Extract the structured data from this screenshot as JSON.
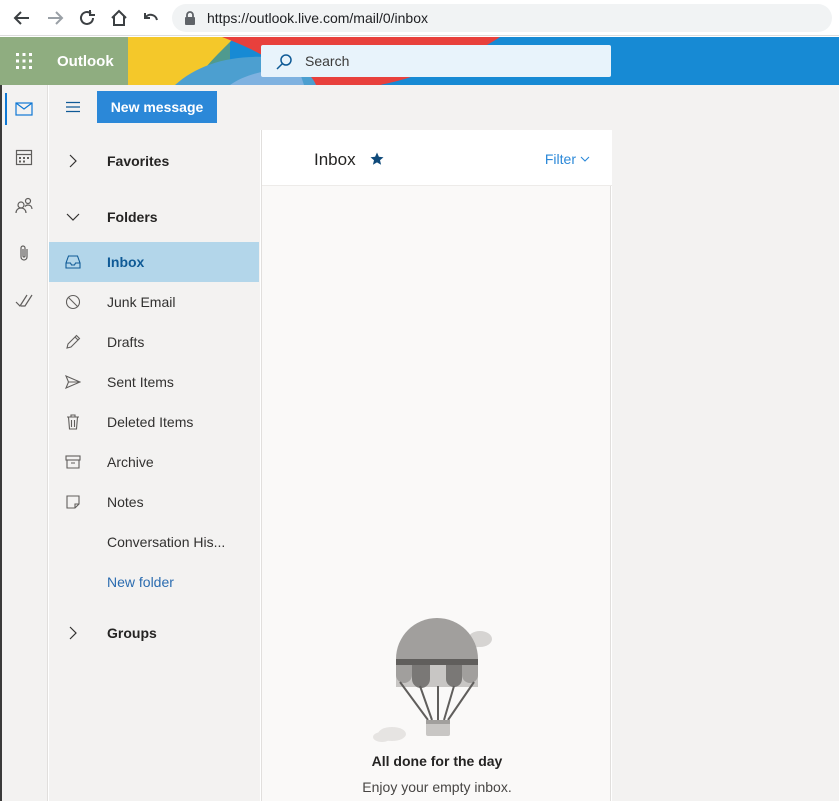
{
  "browser": {
    "url": "https://outlook.live.com/mail/0/inbox"
  },
  "app": {
    "brand": "Outlook",
    "accent_color": "#0f78d4",
    "brand_color": "#8fad80"
  },
  "search": {
    "placeholder": "Search"
  },
  "rail": {
    "items": [
      {
        "icon": "mail-icon",
        "active": true
      },
      {
        "icon": "calendar-icon",
        "active": false
      },
      {
        "icon": "people-icon",
        "active": false
      },
      {
        "icon": "attachment-icon",
        "active": false
      },
      {
        "icon": "todo-check-icon",
        "active": false
      }
    ]
  },
  "toolbar": {
    "new_message_label": "New message"
  },
  "folder_pane": {
    "favorites_label": "Favorites",
    "folders_label": "Folders",
    "groups_label": "Groups",
    "items": [
      {
        "label": "Inbox",
        "icon": "inbox-icon",
        "selected": true
      },
      {
        "label": "Junk Email",
        "icon": "blocked-icon"
      },
      {
        "label": "Drafts",
        "icon": "pencil-icon"
      },
      {
        "label": "Sent Items",
        "icon": "send-icon"
      },
      {
        "label": "Deleted Items",
        "icon": "trash-icon"
      },
      {
        "label": "Archive",
        "icon": "archive-icon"
      },
      {
        "label": "Notes",
        "icon": "note-icon"
      },
      {
        "label": "Conversation His...",
        "icon": ""
      }
    ],
    "new_folder_label": "New folder"
  },
  "message_list": {
    "title": "Inbox",
    "filter_label": "Filter",
    "empty_title": "All done for the day",
    "empty_subtitle": "Enjoy your empty inbox."
  }
}
